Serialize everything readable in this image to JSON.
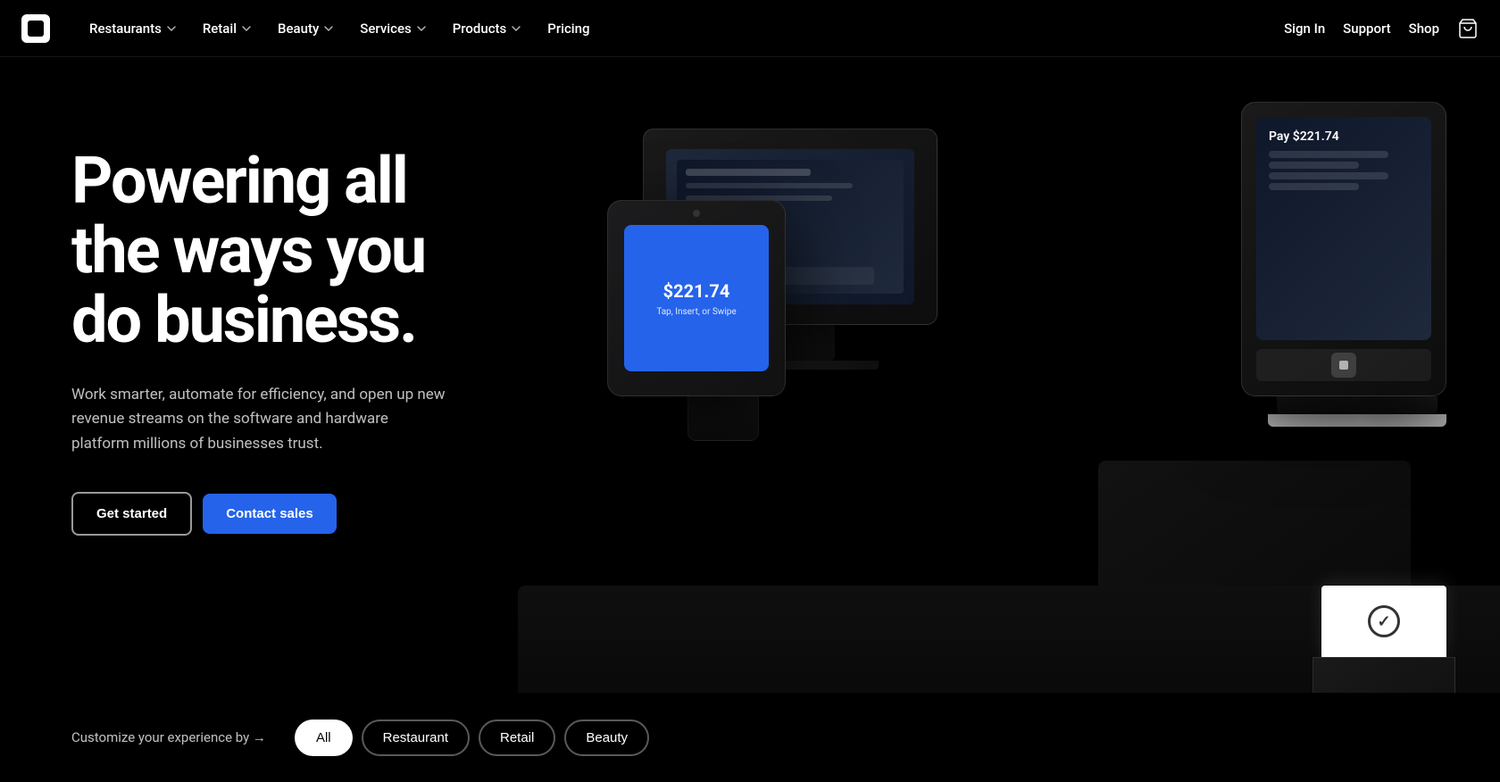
{
  "brand": {
    "name": "Square",
    "logo_alt": "Square logo"
  },
  "nav": {
    "links": [
      {
        "id": "restaurants",
        "label": "Restaurants",
        "has_dropdown": true
      },
      {
        "id": "retail",
        "label": "Retail",
        "has_dropdown": true
      },
      {
        "id": "beauty",
        "label": "Beauty",
        "has_dropdown": true
      },
      {
        "id": "services",
        "label": "Services",
        "has_dropdown": true
      },
      {
        "id": "products",
        "label": "Products",
        "has_dropdown": true
      },
      {
        "id": "pricing",
        "label": "Pricing",
        "has_dropdown": false
      }
    ],
    "right_links": [
      {
        "id": "sign-in",
        "label": "Sign In"
      },
      {
        "id": "support",
        "label": "Support"
      },
      {
        "id": "shop",
        "label": "Shop"
      }
    ]
  },
  "hero": {
    "headline_line1": "Powering all",
    "headline_line2": "the ways you",
    "headline_line3": "do business.",
    "subtext": "Work smarter, automate for efficiency, and open up new revenue streams on the software and hardware platform millions of businesses trust.",
    "cta_primary": "Get started",
    "cta_secondary": "Contact sales"
  },
  "terminal": {
    "pay_label": "Pay $221.74"
  },
  "reader": {
    "amount": "$221.74",
    "instruction": "Tap, Insert, or Swipe"
  },
  "bottom_bar": {
    "customize_label": "Customize your experience by →",
    "pills": [
      {
        "id": "all",
        "label": "All",
        "active": true
      },
      {
        "id": "restaurant",
        "label": "Restaurant",
        "active": false
      },
      {
        "id": "retail",
        "label": "Retail",
        "active": false
      },
      {
        "id": "beauty",
        "label": "Beauty",
        "active": false
      }
    ]
  }
}
